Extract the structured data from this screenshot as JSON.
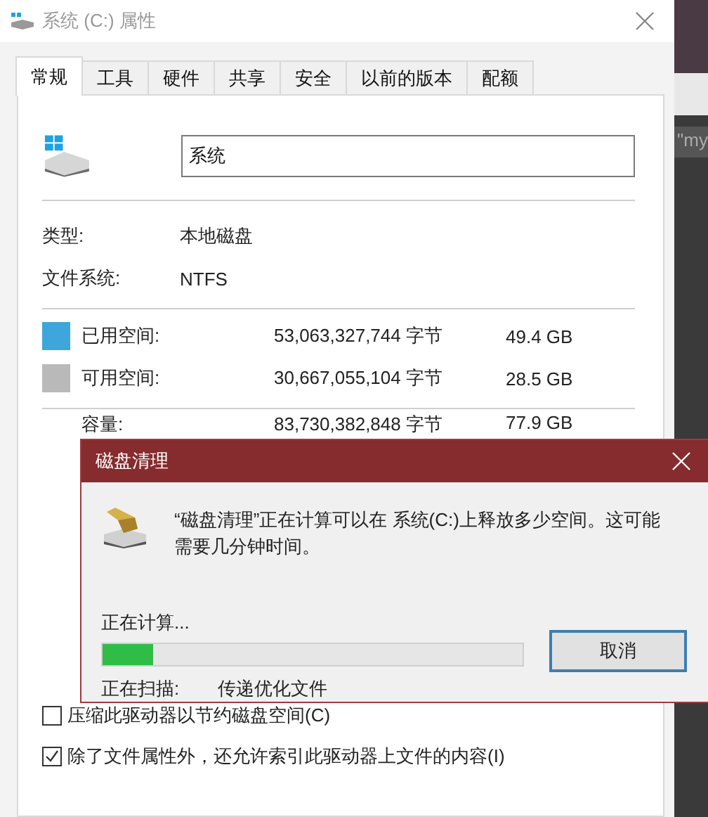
{
  "properties": {
    "title": "系统 (C:) 属性",
    "tabs": [
      {
        "label": "常规",
        "selected": true
      },
      {
        "label": "工具",
        "selected": false
      },
      {
        "label": "硬件",
        "selected": false
      },
      {
        "label": "共享",
        "selected": false
      },
      {
        "label": "安全",
        "selected": false
      },
      {
        "label": "以前的版本",
        "selected": false
      },
      {
        "label": "配额",
        "selected": false
      }
    ],
    "name_field": "系统",
    "info": [
      {
        "label": "类型:",
        "value": "本地磁盘"
      },
      {
        "label": "文件系统:",
        "value": "NTFS"
      }
    ],
    "space": [
      {
        "label": "已用空间:",
        "bytes": "53,063,327,744 字节",
        "size": "49.4 GB",
        "color": "#3fa6dc"
      },
      {
        "label": "可用空间:",
        "bytes": "30,667,055,104 字节",
        "size": "28.5 GB",
        "color": "#b9b9b9"
      }
    ],
    "capacity": {
      "label": "容量:",
      "bytes": "83,730,382,848 字节",
      "size": "77.9 GB"
    },
    "checkboxes": [
      {
        "label": "压缩此驱动器以节约磁盘空间(C)",
        "checked": false
      },
      {
        "label": "除了文件属性外，还允许索引此驱动器上文件的内容(I)",
        "checked": true
      }
    ]
  },
  "cleanup": {
    "title": "磁盘清理",
    "message": "“磁盘清理”正在计算可以在 系统(C:)上释放多少空间。这可能需要几分钟时间。",
    "status": "正在计算...",
    "progress": {
      "level": 0.12
    },
    "cancel": "取消",
    "scan_label": "正在扫描:",
    "scan_item": "传递优化文件"
  },
  "background": {
    "text": "\"my"
  }
}
